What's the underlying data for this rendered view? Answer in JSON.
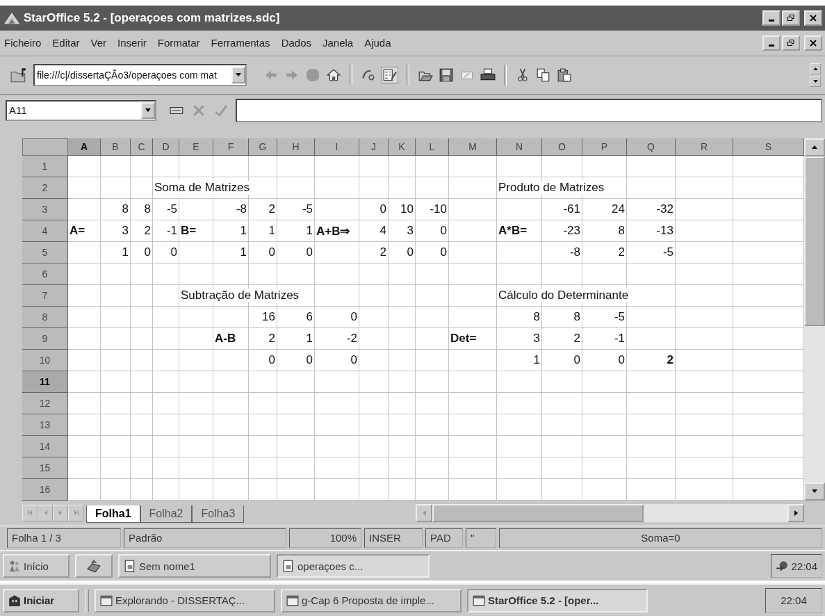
{
  "window": {
    "title": "StarOffice 5.2 - [operaçoes com matrizes.sdc]"
  },
  "menu": [
    "Ficheiro",
    "Editar",
    "Ver",
    "Inserir",
    "Formatar",
    "Ferramentas",
    "Dados",
    "Janela",
    "Ajuda"
  ],
  "toolbar": {
    "url": "file:///c|/dissertaÇÃo3/operaçoes com mat"
  },
  "formula_bar": {
    "cell_reference": "A11"
  },
  "sheet": {
    "columns": [
      {
        "label": "A",
        "selected": true
      },
      {
        "label": "B",
        "selected": false
      },
      {
        "label": "C",
        "selected": false
      },
      {
        "label": "D",
        "selected": false
      },
      {
        "label": "E",
        "selected": false
      },
      {
        "label": "F",
        "selected": false
      },
      {
        "label": "G",
        "selected": false
      },
      {
        "label": "H",
        "selected": false
      },
      {
        "label": "I",
        "selected": false
      },
      {
        "label": "J",
        "selected": false
      },
      {
        "label": "K",
        "selected": false
      },
      {
        "label": "L",
        "selected": false
      },
      {
        "label": "M",
        "selected": false
      },
      {
        "label": "N",
        "selected": false
      },
      {
        "label": "O",
        "selected": false
      },
      {
        "label": "P",
        "selected": false
      },
      {
        "label": "Q",
        "selected": false
      },
      {
        "label": "R",
        "selected": false
      },
      {
        "label": "S",
        "selected": false
      }
    ],
    "rows": [
      {
        "header": "1",
        "selected": false,
        "cells": []
      },
      {
        "header": "2",
        "selected": false,
        "cells": [
          {},
          {},
          {},
          {
            "kind": "title",
            "text": "Soma de Matrizes"
          },
          {},
          {},
          {},
          {},
          {},
          {},
          {},
          {},
          {},
          {
            "kind": "title",
            "text": "Produto de Matrizes"
          }
        ]
      },
      {
        "header": "3",
        "selected": false,
        "cells": [
          {},
          {
            "kind": "number",
            "text": "8"
          },
          {
            "kind": "number",
            "text": "8"
          },
          {
            "kind": "number",
            "text": "-5"
          },
          {},
          {
            "kind": "number",
            "text": "-8"
          },
          {
            "kind": "number",
            "text": "2"
          },
          {
            "kind": "number",
            "text": "-5"
          },
          {},
          {
            "kind": "number",
            "text": "0"
          },
          {
            "kind": "number",
            "text": "10"
          },
          {
            "kind": "number",
            "text": "-10"
          },
          {},
          {},
          {
            "kind": "number",
            "text": "-61"
          },
          {
            "kind": "number",
            "text": "24"
          },
          {
            "kind": "number",
            "text": "-32"
          }
        ]
      },
      {
        "header": "4",
        "selected": false,
        "cells": [
          {
            "kind": "label",
            "text": "A="
          },
          {
            "kind": "number",
            "text": "3"
          },
          {
            "kind": "number",
            "text": "2"
          },
          {
            "kind": "number",
            "text": "-1"
          },
          {
            "kind": "label",
            "text": "B="
          },
          {
            "kind": "number",
            "text": "1"
          },
          {
            "kind": "number",
            "text": "1"
          },
          {
            "kind": "number",
            "text": "1"
          },
          {
            "kind": "label",
            "text": "A+B⇒"
          },
          {
            "kind": "number",
            "text": "4"
          },
          {
            "kind": "number",
            "text": "3"
          },
          {
            "kind": "number",
            "text": "0"
          },
          {},
          {
            "kind": "label",
            "text": "A*B="
          },
          {
            "kind": "number",
            "text": "-23"
          },
          {
            "kind": "number",
            "text": "8"
          },
          {
            "kind": "number",
            "text": "-13"
          }
        ]
      },
      {
        "header": "5",
        "selected": false,
        "cells": [
          {},
          {
            "kind": "number",
            "text": "1"
          },
          {
            "kind": "number",
            "text": "0"
          },
          {
            "kind": "number",
            "text": "0"
          },
          {},
          {
            "kind": "number",
            "text": "1"
          },
          {
            "kind": "number",
            "text": "0"
          },
          {
            "kind": "number",
            "text": "0"
          },
          {},
          {
            "kind": "number",
            "text": "2"
          },
          {
            "kind": "number",
            "text": "0"
          },
          {
            "kind": "number",
            "text": "0"
          },
          {},
          {},
          {
            "kind": "number",
            "text": "-8"
          },
          {
            "kind": "number",
            "text": "2"
          },
          {
            "kind": "number",
            "text": "-5"
          }
        ]
      },
      {
        "header": "6",
        "selected": false,
        "cells": []
      },
      {
        "header": "7",
        "selected": false,
        "cells": [
          {},
          {},
          {},
          {},
          {
            "kind": "title",
            "text": "Subtração de Matrizes"
          },
          {},
          {},
          {},
          {},
          {},
          {},
          {},
          {},
          {
            "kind": "title",
            "text": "Cálculo do Determinante"
          }
        ]
      },
      {
        "header": "8",
        "selected": false,
        "cells": [
          {},
          {},
          {},
          {},
          {},
          {},
          {
            "kind": "number",
            "text": "16"
          },
          {
            "kind": "number",
            "text": "6"
          },
          {
            "kind": "number",
            "text": "0"
          },
          {},
          {},
          {},
          {},
          {
            "kind": "number",
            "text": "8"
          },
          {
            "kind": "number",
            "text": "8"
          },
          {
            "kind": "number",
            "text": "-5"
          }
        ]
      },
      {
        "header": "9",
        "selected": false,
        "cells": [
          {},
          {},
          {},
          {},
          {},
          {
            "kind": "label",
            "text": "A-B"
          },
          {
            "kind": "number",
            "text": "2"
          },
          {
            "kind": "number",
            "text": "1"
          },
          {
            "kind": "number",
            "text": "-2"
          },
          {},
          {},
          {},
          {
            "kind": "label",
            "text": "Det="
          },
          {
            "kind": "number",
            "text": "3"
          },
          {
            "kind": "number",
            "text": "2"
          },
          {
            "kind": "number",
            "text": "-1"
          }
        ]
      },
      {
        "header": "10",
        "selected": false,
        "cells": [
          {},
          {},
          {},
          {},
          {},
          {},
          {
            "kind": "number",
            "text": "0"
          },
          {
            "kind": "number",
            "text": "0"
          },
          {
            "kind": "number",
            "text": "0"
          },
          {},
          {},
          {},
          {},
          {
            "kind": "number",
            "text": "1"
          },
          {
            "kind": "number",
            "text": "0"
          },
          {
            "kind": "number",
            "text": "0"
          },
          {
            "kind": "result",
            "text": "2"
          }
        ]
      },
      {
        "header": "11",
        "selected": true,
        "cells": []
      },
      {
        "header": "12",
        "selected": false,
        "cells": []
      },
      {
        "header": "13",
        "selected": false,
        "cells": []
      },
      {
        "header": "14",
        "selected": false,
        "cells": []
      },
      {
        "header": "15",
        "selected": false,
        "cells": []
      },
      {
        "header": "16",
        "selected": false,
        "cells": []
      }
    ]
  },
  "sheet_tabs": [
    {
      "label": "Folha1",
      "selected": true
    },
    {
      "label": "Folha2",
      "selected": false
    },
    {
      "label": "Folha3",
      "selected": false
    }
  ],
  "status_bar": [
    "Folha 1 / 3",
    "Padrão",
    "100%",
    "INSER",
    "PAD",
    "\"",
    "Soma=0"
  ],
  "office_taskbar": {
    "start": "Início",
    "tasks": [
      {
        "label": "Sem nome1",
        "selected": false
      },
      {
        "label": "operaçoes c...",
        "selected": true
      }
    ],
    "clock": "22:04"
  },
  "windows_taskbar": {
    "start": "Iniciar",
    "tasks": [
      {
        "label": "Explorando - DISSERTAÇ...",
        "selected": false
      },
      {
        "label": "g-Cap 6 Proposta de imple...",
        "selected": false
      },
      {
        "label": "StarOffice 5.2 - [oper...",
        "selected": true
      }
    ],
    "clock": "22:04"
  }
}
